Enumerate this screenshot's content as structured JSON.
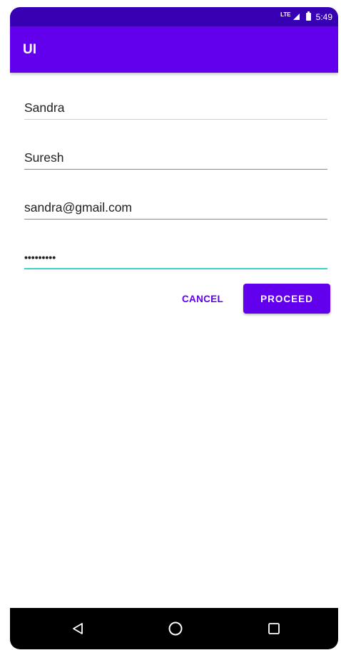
{
  "status_bar": {
    "network": "LTE",
    "time": "5:49"
  },
  "app_bar": {
    "title": "UI"
  },
  "form": {
    "first_name": {
      "value": "Sandra"
    },
    "last_name": {
      "value": "Suresh"
    },
    "email": {
      "value": "sandra@gmail.com"
    },
    "password": {
      "value": "•••••••••"
    }
  },
  "actions": {
    "cancel_label": "CANCEL",
    "proceed_label": "PROCEED"
  },
  "nav_bar": {
    "back_icon": "back-triangle-icon",
    "home_icon": "home-circle-icon",
    "recents_icon": "recents-square-icon"
  },
  "colors": {
    "primary": "#6200ee",
    "primary_dark": "#3700b3",
    "focus_underline": "#3ad3c8"
  }
}
